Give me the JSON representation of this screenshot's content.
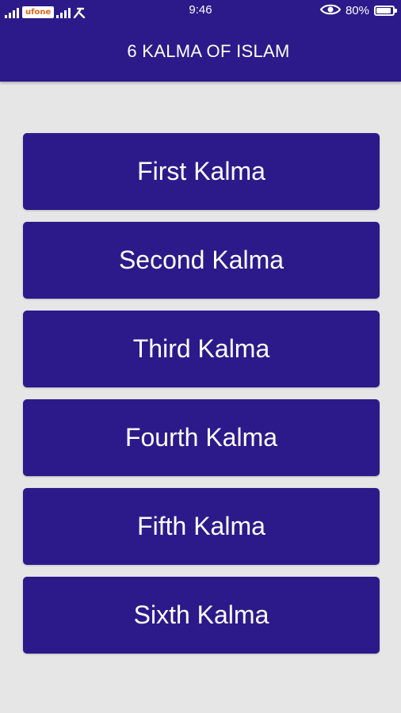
{
  "status_bar": {
    "carrier": "ufone",
    "time": "9:46",
    "battery": "80%",
    "battery_level": 0.8,
    "icons": [
      "signal-icon",
      "carrier-logo",
      "signal-icon",
      "carrier-icon",
      "eye-icon",
      "battery-icon"
    ]
  },
  "app_bar": {
    "title": "6 KALMA OF ISLAM"
  },
  "kalmas": [
    {
      "label": "First Kalma"
    },
    {
      "label": "Second Kalma"
    },
    {
      "label": "Third Kalma"
    },
    {
      "label": "Fourth Kalma"
    },
    {
      "label": "Fifth Kalma"
    },
    {
      "label": "Sixth Kalma"
    }
  ],
  "colors": {
    "primary": "#2c1a8a",
    "background": "#e6e6e6",
    "text": "#ffffff"
  }
}
